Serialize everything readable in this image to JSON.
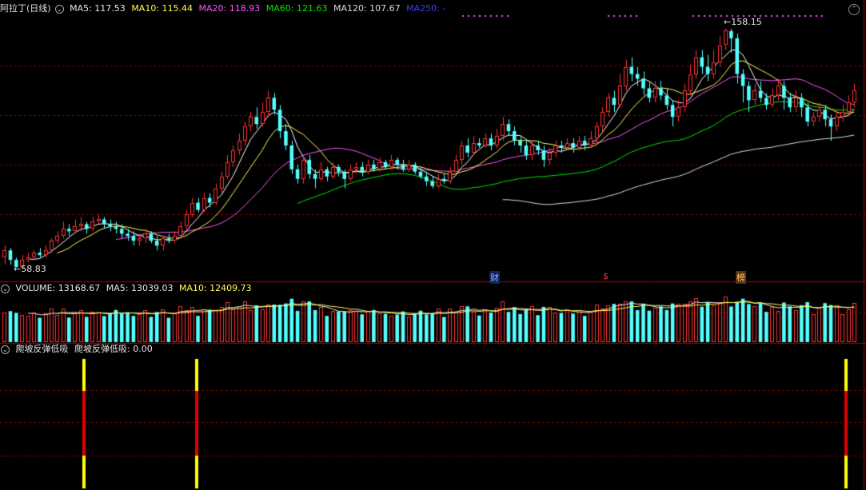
{
  "main_header": {
    "symbol": "阿拉丁(日线)",
    "ma5": "MA5: 117.53",
    "ma10": "MA10: 115.44",
    "ma20": "MA20: 118.93",
    "ma60": "MA60: 121.63",
    "ma120": "MA120: 107.67",
    "ma250": "MA250: -"
  },
  "volume_header": {
    "title": "VOLUME: 13168.67",
    "ma5": "MA5: 13039.03",
    "ma10": "MA10: 12409.73"
  },
  "indicator_header": {
    "name": "爬坡反弹低吸",
    "value": "爬坡反弹低吸: 0.00"
  },
  "annotations": {
    "high_price": "158.15",
    "low_price": "58.83",
    "badge_cai": "财",
    "badge_dollar": "$",
    "badge_bang": "榜"
  },
  "colors": {
    "up": "#ff3232",
    "down": "#54ffff",
    "ma5": "#ffffff",
    "ma10": "#ffff54",
    "ma20": "#ff54ff",
    "ma60": "#00e600",
    "ma120": "#dcdcdc",
    "ma250": "#3c3cff",
    "grid": "#8b0000",
    "signal_yellow": "#ffff00",
    "signal_red": "#e00000"
  },
  "chart_data": {
    "type": "candlestick",
    "price_range": [
      55,
      163
    ],
    "high": 158.15,
    "low": 58.83,
    "candles": [
      [
        63,
        66,
        60,
        68
      ],
      [
        66,
        62,
        60,
        67
      ],
      [
        62,
        59,
        58.83,
        63
      ],
      [
        59,
        62,
        58,
        64
      ],
      [
        62,
        63,
        61,
        65
      ],
      [
        63,
        65,
        62,
        66
      ],
      [
        65,
        64,
        63,
        67
      ],
      [
        64,
        66,
        63,
        68
      ],
      [
        66,
        70,
        65,
        71
      ],
      [
        70,
        72,
        69,
        74
      ],
      [
        72,
        75,
        71,
        78
      ],
      [
        75,
        74,
        72,
        77
      ],
      [
        74,
        76,
        73,
        79
      ],
      [
        76,
        77,
        74,
        80
      ],
      [
        77,
        75,
        73,
        78
      ],
      [
        75,
        78,
        74,
        80
      ],
      [
        78,
        79,
        77,
        81
      ],
      [
        79,
        77,
        75,
        80
      ],
      [
        77,
        76,
        74,
        79
      ],
      [
        76,
        75,
        73,
        78
      ],
      [
        75,
        73,
        71,
        77
      ],
      [
        73,
        72,
        70,
        75
      ],
      [
        72,
        70,
        68,
        74
      ],
      [
        70,
        71,
        68,
        73
      ],
      [
        71,
        73,
        69,
        75
      ],
      [
        73,
        70,
        69,
        74
      ],
      [
        70,
        68,
        66,
        72
      ],
      [
        68,
        71,
        66,
        72
      ],
      [
        71,
        70,
        69,
        73
      ],
      [
        70,
        72,
        69,
        74
      ],
      [
        72,
        76,
        71,
        78
      ],
      [
        76,
        81,
        75,
        83
      ],
      [
        81,
        86,
        80,
        88
      ],
      [
        86,
        83,
        82,
        88
      ],
      [
        83,
        88,
        82,
        90
      ],
      [
        88,
        86,
        84,
        90
      ],
      [
        86,
        92,
        85,
        94
      ],
      [
        92,
        97,
        90,
        99
      ],
      [
        97,
        103,
        96,
        106
      ],
      [
        103,
        108,
        101,
        110
      ],
      [
        108,
        112,
        106,
        115
      ],
      [
        112,
        118,
        110,
        120
      ],
      [
        118,
        122,
        116,
        124
      ],
      [
        122,
        119,
        117,
        126
      ],
      [
        119,
        124,
        118,
        128
      ],
      [
        124,
        130,
        122,
        133
      ],
      [
        130,
        125,
        123,
        132
      ],
      [
        125,
        116,
        113,
        127
      ],
      [
        116,
        110,
        108,
        119
      ],
      [
        110,
        100,
        98,
        112
      ],
      [
        100,
        96,
        94,
        102
      ],
      [
        96,
        104,
        94,
        106
      ],
      [
        104,
        98,
        96,
        106
      ],
      [
        98,
        96,
        92,
        100
      ],
      [
        96,
        100,
        95,
        103
      ],
      [
        100,
        97,
        95,
        101
      ],
      [
        97,
        101,
        96,
        103
      ],
      [
        101,
        99,
        97,
        102
      ],
      [
        99,
        96,
        92,
        100
      ],
      [
        96,
        100,
        95,
        102
      ],
      [
        100,
        101,
        98,
        103
      ],
      [
        101,
        99,
        97,
        103
      ],
      [
        99,
        102,
        98,
        104
      ],
      [
        102,
        100,
        99,
        104
      ],
      [
        100,
        103,
        99,
        105
      ],
      [
        103,
        101,
        100,
        104
      ],
      [
        101,
        104,
        100,
        106
      ],
      [
        104,
        102,
        100,
        105
      ],
      [
        102,
        100,
        99,
        104
      ],
      [
        100,
        102,
        99,
        104
      ],
      [
        102,
        99,
        98,
        103
      ],
      [
        99,
        97,
        96,
        101
      ],
      [
        97,
        95,
        93,
        99
      ],
      [
        95,
        93,
        92,
        97
      ],
      [
        93,
        96,
        92,
        98
      ],
      [
        96,
        95,
        94,
        98
      ],
      [
        95,
        99,
        94,
        101
      ],
      [
        99,
        104,
        98,
        106
      ],
      [
        104,
        110,
        102,
        112
      ],
      [
        110,
        107,
        105,
        113
      ],
      [
        107,
        111,
        106,
        114
      ],
      [
        111,
        110,
        109,
        113
      ],
      [
        110,
        113,
        109,
        115
      ],
      [
        113,
        110,
        108,
        115
      ],
      [
        110,
        114,
        109,
        117
      ],
      [
        114,
        119,
        112,
        122
      ],
      [
        119,
        116,
        114,
        121
      ],
      [
        116,
        112,
        110,
        118
      ],
      [
        112,
        110,
        107,
        114
      ],
      [
        110,
        106,
        104,
        112
      ],
      [
        106,
        110,
        104,
        112
      ],
      [
        110,
        108,
        106,
        112
      ],
      [
        108,
        104,
        101,
        110
      ],
      [
        104,
        107,
        102,
        109
      ],
      [
        107,
        110,
        105,
        112
      ],
      [
        110,
        109,
        107,
        112
      ],
      [
        109,
        111,
        108,
        113
      ],
      [
        111,
        109,
        107,
        113
      ],
      [
        109,
        112,
        108,
        114
      ],
      [
        112,
        110,
        108,
        114
      ],
      [
        110,
        113,
        109,
        116
      ],
      [
        113,
        118,
        111,
        120
      ],
      [
        118,
        124,
        116,
        126
      ],
      [
        124,
        130,
        122,
        132
      ],
      [
        130,
        127,
        124,
        133
      ],
      [
        127,
        135,
        126,
        140
      ],
      [
        135,
        143,
        133,
        146
      ],
      [
        143,
        140,
        137,
        147
      ],
      [
        140,
        138,
        135,
        143
      ],
      [
        138,
        134,
        131,
        141
      ],
      [
        134,
        130,
        128,
        137
      ],
      [
        130,
        134,
        128,
        137
      ],
      [
        134,
        131,
        129,
        137
      ],
      [
        131,
        127,
        125,
        134
      ],
      [
        127,
        122,
        118,
        129
      ],
      [
        122,
        126,
        120,
        129
      ],
      [
        126,
        133,
        124,
        136
      ],
      [
        133,
        140,
        131,
        144
      ],
      [
        140,
        147,
        138,
        150
      ],
      [
        147,
        143,
        140,
        150
      ],
      [
        143,
        140,
        137,
        148
      ],
      [
        140,
        145,
        138,
        150
      ],
      [
        145,
        152,
        143,
        156
      ],
      [
        152,
        158.15,
        150,
        159
      ],
      [
        158,
        155,
        149,
        159
      ],
      [
        155,
        140,
        136,
        157
      ],
      [
        140,
        135,
        128,
        142
      ],
      [
        135,
        129,
        124,
        137
      ],
      [
        129,
        133,
        127,
        136
      ],
      [
        133,
        130,
        128,
        137
      ],
      [
        130,
        127,
        125,
        132
      ],
      [
        127,
        131,
        126,
        134
      ],
      [
        131,
        135,
        129,
        138
      ],
      [
        135,
        130,
        125,
        137
      ],
      [
        130,
        126,
        124,
        132
      ],
      [
        126,
        130,
        124,
        133
      ],
      [
        130,
        126,
        122,
        132
      ],
      [
        126,
        120,
        118,
        128
      ],
      [
        120,
        122,
        118,
        124
      ],
      [
        122,
        125,
        120,
        128
      ],
      [
        125,
        121,
        118,
        127
      ],
      [
        121,
        118,
        112,
        123
      ],
      [
        118,
        122,
        116,
        125
      ],
      [
        122,
        124,
        120,
        127
      ],
      [
        124,
        128,
        123,
        131
      ],
      [
        128,
        133,
        126,
        136
      ]
    ],
    "signal_positions": [
      0.095,
      0.225,
      0.975
    ],
    "ma_visible": [
      "MA5",
      "MA10",
      "MA20",
      "MA60",
      "MA120"
    ]
  }
}
